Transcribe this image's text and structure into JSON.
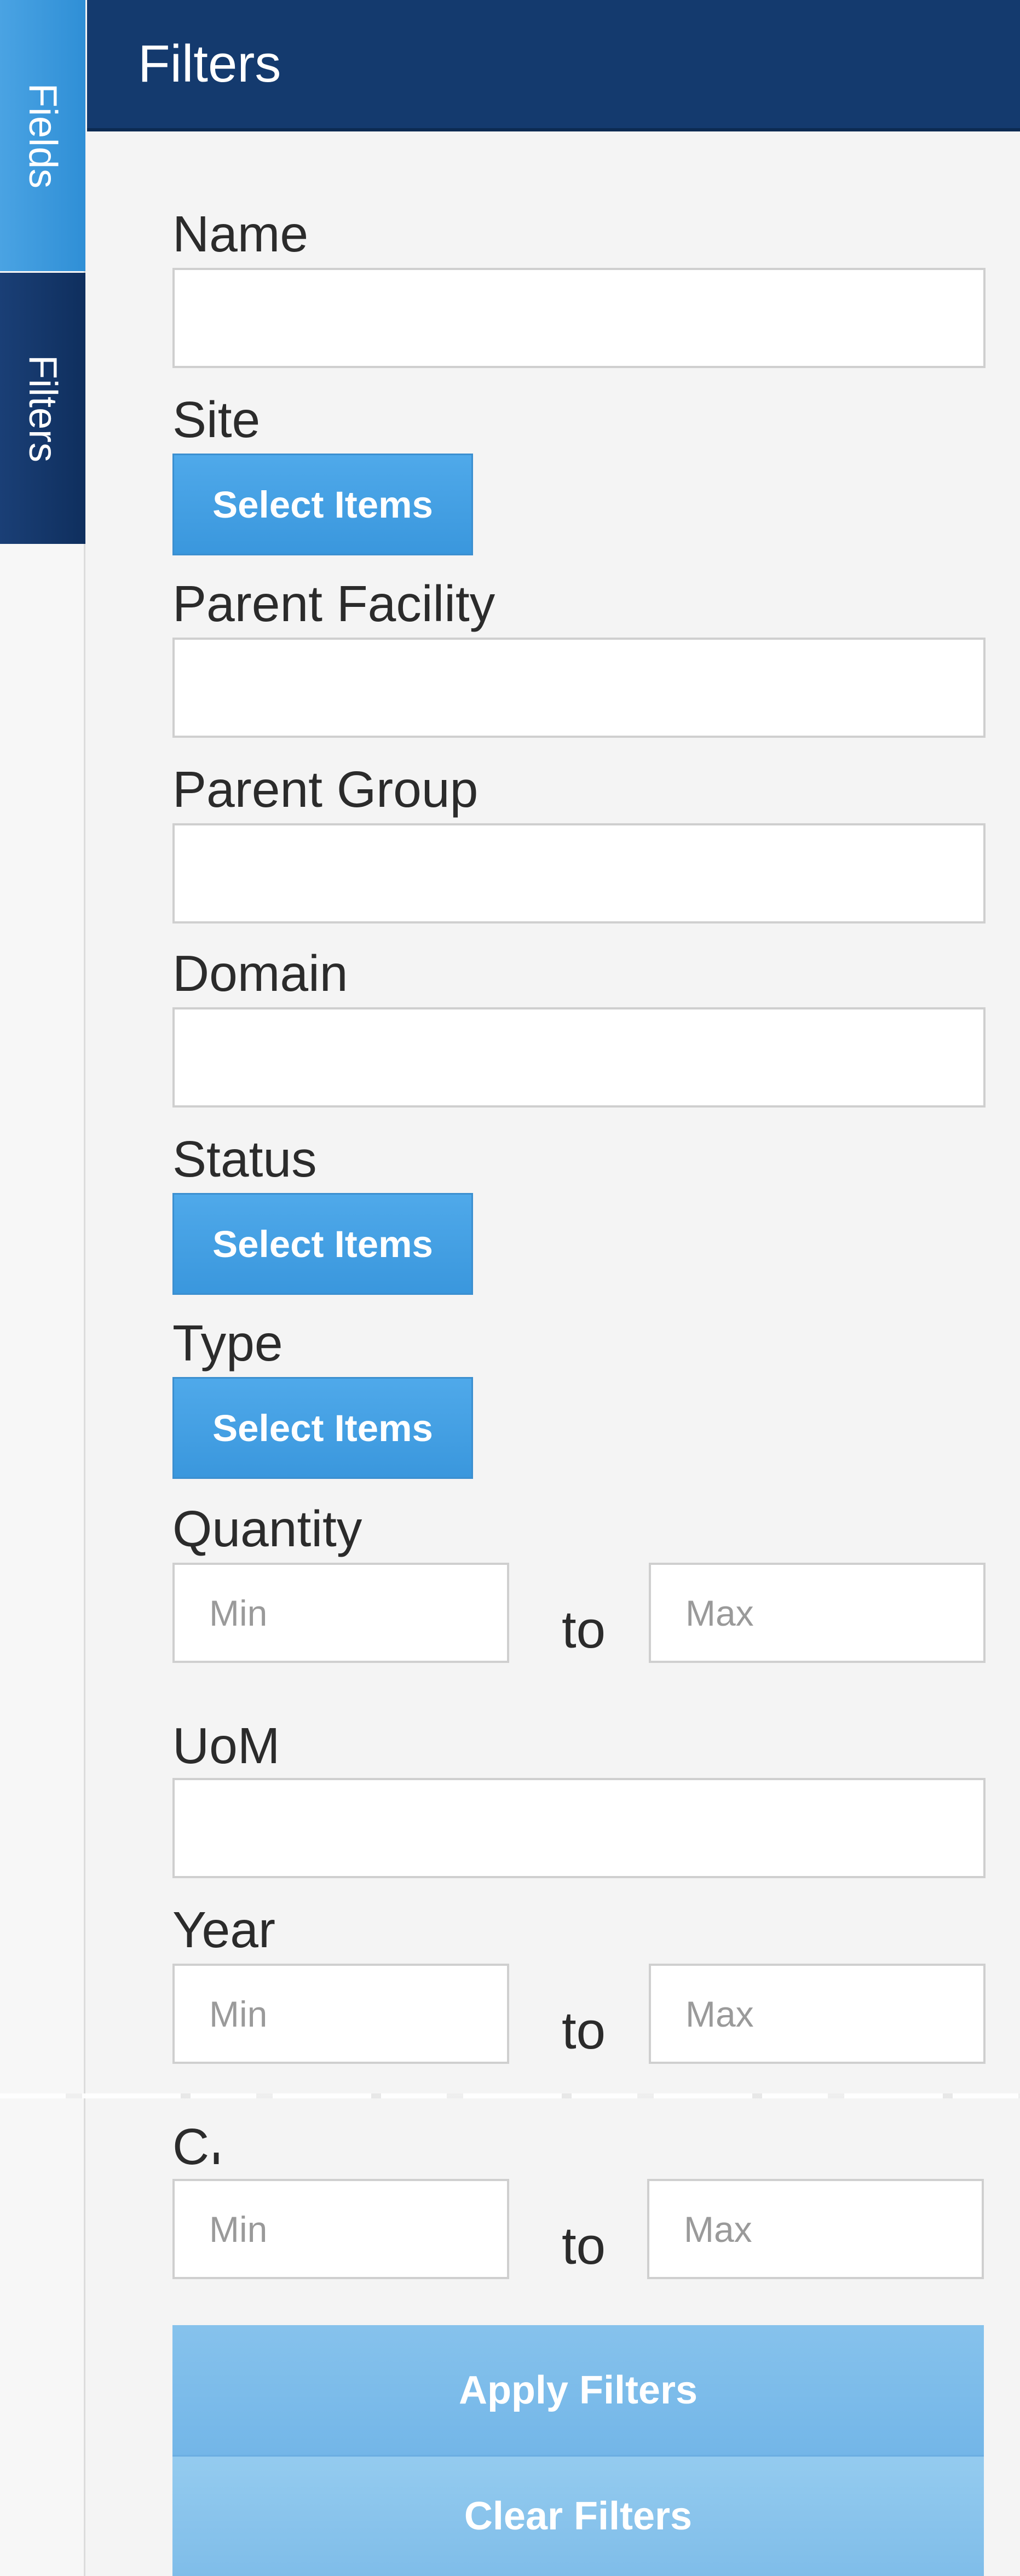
{
  "tabs": {
    "fields_label": "Fields",
    "filters_label": "Filters"
  },
  "header": {
    "title": "Filters"
  },
  "filters": {
    "name": {
      "label": "Name",
      "value": ""
    },
    "site": {
      "label": "Site",
      "button_label": "Select Items"
    },
    "parent_facility": {
      "label": "Parent Facility",
      "value": ""
    },
    "parent_group": {
      "label": "Parent Group",
      "value": ""
    },
    "domain": {
      "label": "Domain",
      "value": ""
    },
    "status": {
      "label": "Status",
      "button_label": "Select Items"
    },
    "type": {
      "label": "Type",
      "button_label": "Select Items"
    },
    "quantity": {
      "label": "Quantity",
      "min_placeholder": "Min",
      "max_placeholder": "Max",
      "to_text": "to"
    },
    "uom": {
      "label": "UoM",
      "value": ""
    },
    "year": {
      "label": "Year",
      "min_placeholder": "Min",
      "max_placeholder": "Max",
      "to_text": "to"
    },
    "ci": {
      "label": "CI",
      "min_placeholder": "Min",
      "max_placeholder": "Max",
      "to_text": "to"
    }
  },
  "actions": {
    "apply_label": "Apply Filters",
    "clear_label": "Clear Filters"
  },
  "colors": {
    "header_bg": "#143a6e",
    "tab_fields_bg": "#3a97dd",
    "tab_filters_bg": "#143a6e",
    "select_button_bg": "#3a97dd",
    "apply_button_bg": "#7ab9e9"
  }
}
